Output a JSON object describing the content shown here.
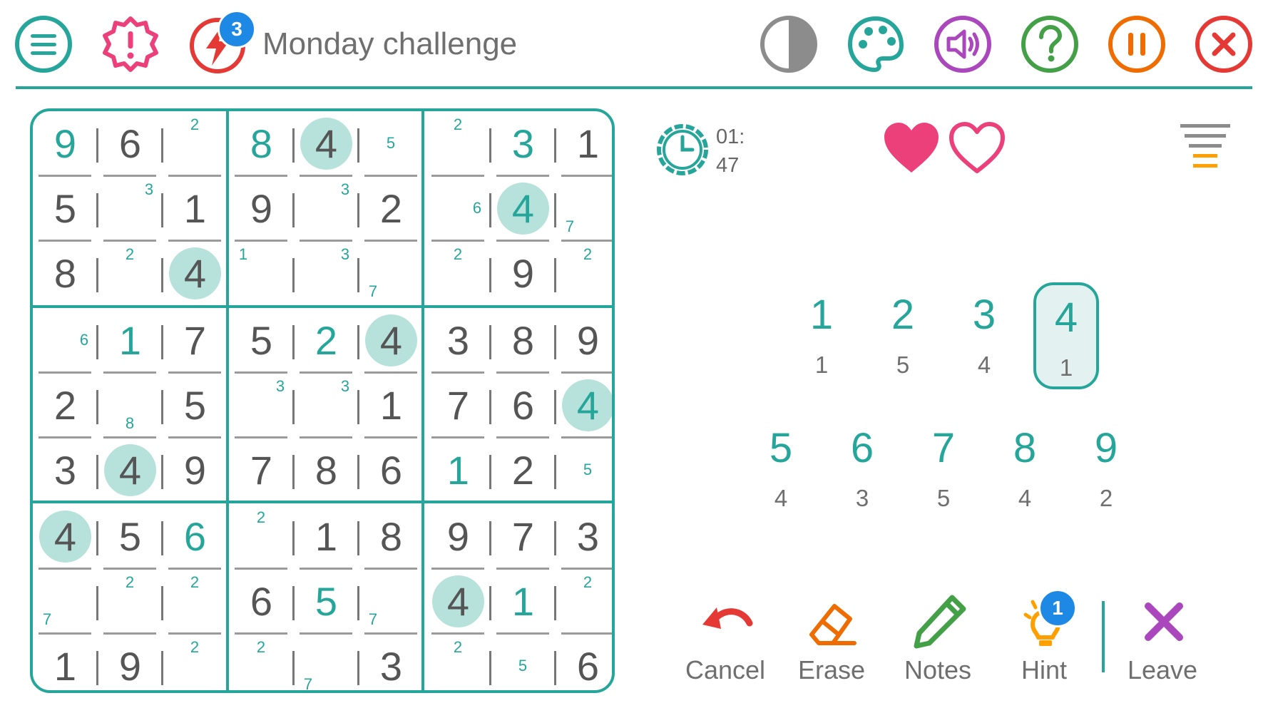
{
  "header": {
    "title": "Monday challenge",
    "challenge_badge": "3",
    "icons": {
      "menu": "menu-icon",
      "alert": "alert-badge-icon",
      "challenge": "lightning-icon",
      "contrast": "contrast-icon",
      "palette": "palette-icon",
      "sound": "volume-icon",
      "help": "help-icon",
      "pause": "pause-icon",
      "close": "close-icon"
    }
  },
  "timer": {
    "minutes": "01:",
    "seconds": "47"
  },
  "lives": {
    "total": 2,
    "remaining": 1
  },
  "board": {
    "cells": [
      [
        {
          "v": "9",
          "t": "user"
        },
        {
          "v": "6",
          "t": "given"
        },
        {
          "n": [
            "2"
          ]
        },
        {
          "v": "8",
          "t": "user"
        },
        {
          "v": "4",
          "t": "given",
          "h": true
        },
        {
          "n": [
            "5"
          ]
        },
        {
          "n": [
            "2"
          ]
        },
        {
          "v": "3",
          "t": "user"
        },
        {
          "v": "1",
          "t": "given"
        }
      ],
      [
        {
          "v": "5",
          "t": "given"
        },
        {
          "n": [
            "3"
          ]
        },
        {
          "v": "1",
          "t": "given"
        },
        {
          "v": "9",
          "t": "given"
        },
        {
          "n": [
            "3"
          ]
        },
        {
          "v": "2",
          "t": "given"
        },
        {
          "n": [
            "6"
          ]
        },
        {
          "v": "4",
          "t": "user",
          "h": true
        },
        {
          "n": [
            "7"
          ]
        }
      ],
      [
        {
          "v": "8",
          "t": "given"
        },
        {
          "n": [
            "2"
          ]
        },
        {
          "v": "4",
          "t": "given",
          "h": true
        },
        {
          "n": [
            "1"
          ]
        },
        {
          "n": [
            "3"
          ]
        },
        {
          "n": [
            "7"
          ]
        },
        {
          "n": [
            "2"
          ]
        },
        {
          "v": "9",
          "t": "given"
        },
        {
          "n": [
            "2"
          ]
        }
      ],
      [
        {
          "n": [
            "6"
          ]
        },
        {
          "v": "1",
          "t": "user"
        },
        {
          "v": "7",
          "t": "given"
        },
        {
          "v": "5",
          "t": "given"
        },
        {
          "v": "2",
          "t": "user"
        },
        {
          "v": "4",
          "t": "given",
          "h": true
        },
        {
          "v": "3",
          "t": "given"
        },
        {
          "v": "8",
          "t": "given"
        },
        {
          "v": "9",
          "t": "given"
        }
      ],
      [
        {
          "v": "2",
          "t": "given"
        },
        {
          "n": [
            "8"
          ]
        },
        {
          "v": "5",
          "t": "given"
        },
        {
          "n": [
            "3"
          ]
        },
        {
          "n": [
            "3"
          ]
        },
        {
          "v": "1",
          "t": "given"
        },
        {
          "v": "7",
          "t": "given"
        },
        {
          "v": "6",
          "t": "given"
        },
        {
          "v": "4",
          "t": "user",
          "h": true
        }
      ],
      [
        {
          "v": "3",
          "t": "given"
        },
        {
          "v": "4",
          "t": "given",
          "h": true
        },
        {
          "v": "9",
          "t": "given"
        },
        {
          "v": "7",
          "t": "given"
        },
        {
          "v": "8",
          "t": "given"
        },
        {
          "v": "6",
          "t": "given"
        },
        {
          "v": "1",
          "t": "user"
        },
        {
          "v": "2",
          "t": "given"
        },
        {
          "n": [
            "5"
          ]
        }
      ],
      [
        {
          "v": "4",
          "t": "given",
          "h": true
        },
        {
          "v": "5",
          "t": "given"
        },
        {
          "v": "6",
          "t": "user"
        },
        {
          "n": [
            "2"
          ]
        },
        {
          "v": "1",
          "t": "given"
        },
        {
          "v": "8",
          "t": "given"
        },
        {
          "v": "9",
          "t": "given"
        },
        {
          "v": "7",
          "t": "given"
        },
        {
          "v": "3",
          "t": "given"
        }
      ],
      [
        {
          "n": [
            "7"
          ]
        },
        {
          "n": [
            "2"
          ]
        },
        {
          "n": [
            "2"
          ]
        },
        {
          "v": "6",
          "t": "given"
        },
        {
          "v": "5",
          "t": "user"
        },
        {
          "n": [
            "7"
          ]
        },
        {
          "v": "4",
          "t": "given",
          "h": true
        },
        {
          "v": "1",
          "t": "user"
        },
        {
          "n": [
            "2"
          ]
        }
      ],
      [
        {
          "v": "1",
          "t": "given"
        },
        {
          "v": "9",
          "t": "given"
        },
        {
          "n": [
            "2"
          ]
        },
        {
          "n": [
            "2"
          ]
        },
        {
          "n": [
            "7"
          ]
        },
        {
          "v": "3",
          "t": "given"
        },
        {
          "n": [
            "2"
          ]
        },
        {
          "n": [
            "5"
          ]
        },
        {
          "v": "6",
          "t": "given"
        }
      ]
    ]
  },
  "numpad": [
    {
      "digit": "1",
      "count": "1"
    },
    {
      "digit": "2",
      "count": "5"
    },
    {
      "digit": "3",
      "count": "4"
    },
    {
      "digit": "4",
      "count": "1",
      "selected": true
    },
    {
      "digit": "5",
      "count": "4"
    },
    {
      "digit": "6",
      "count": "3"
    },
    {
      "digit": "7",
      "count": "5"
    },
    {
      "digit": "8",
      "count": "4"
    },
    {
      "digit": "9",
      "count": "2"
    }
  ],
  "actions": {
    "cancel": "Cancel",
    "erase": "Erase",
    "notes": "Notes",
    "hint": "Hint",
    "hint_badge": "1",
    "leave": "Leave"
  },
  "colors": {
    "accent": "#26a69a",
    "highlight": "#b7e2dc",
    "heart": "#ec407a",
    "red": "#e53935",
    "orange": "#ef6c00",
    "purple": "#ab47bc",
    "green": "#43a047",
    "amber": "#ffa000",
    "blue": "#1e88e5"
  }
}
